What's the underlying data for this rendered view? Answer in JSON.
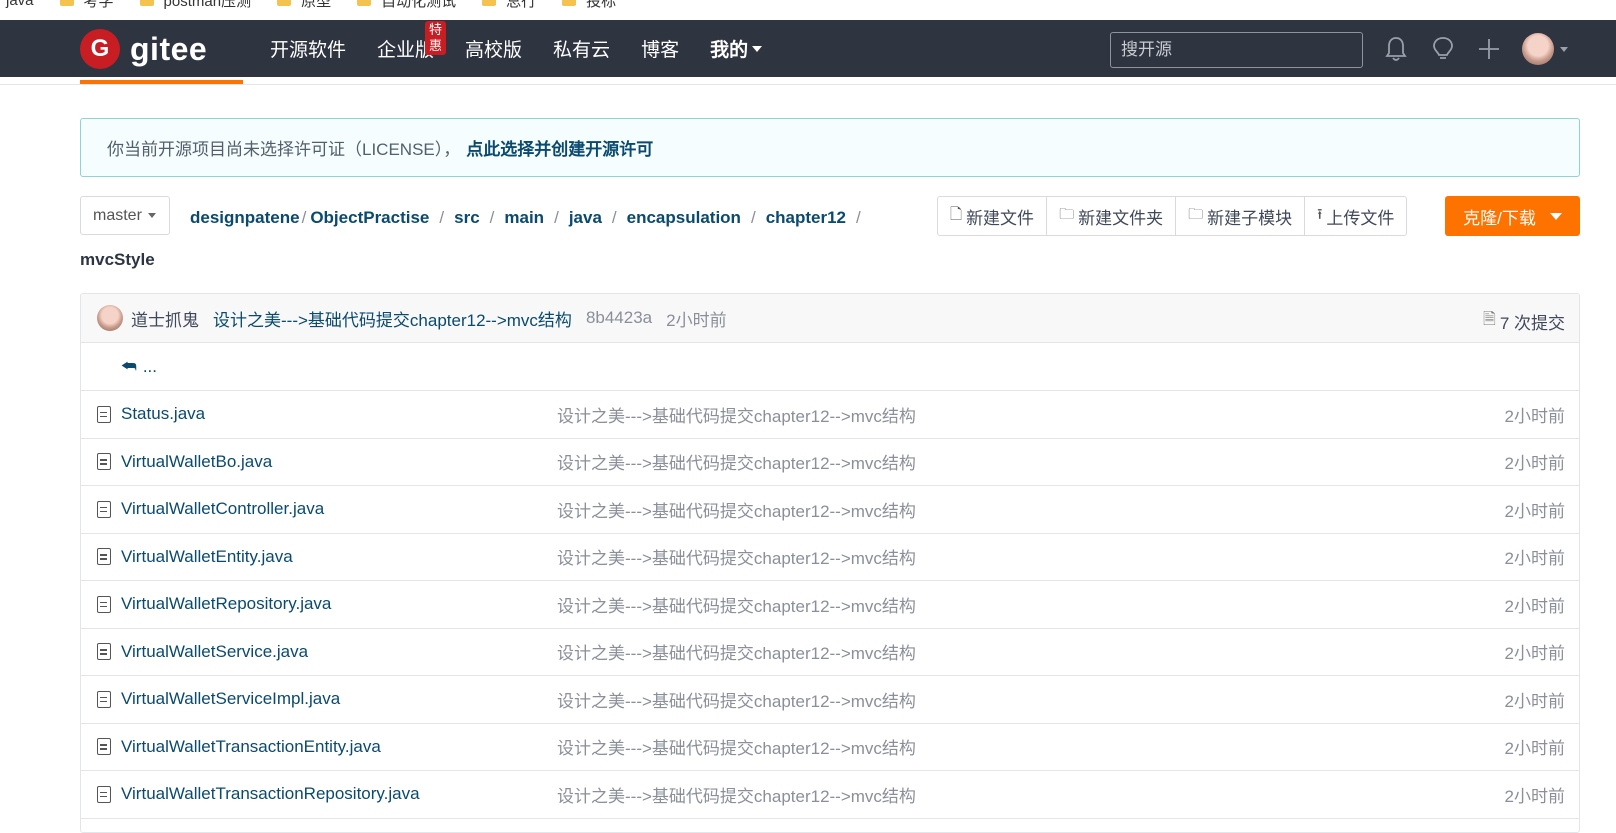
{
  "bookmarks": [
    "java",
    "考学",
    "postman压测",
    "原型",
    "自动化测试",
    "总行",
    "投标"
  ],
  "header": {
    "logo_text": "gitee",
    "nav": [
      {
        "label": "开源软件"
      },
      {
        "label": "企业版",
        "badge": "特惠"
      },
      {
        "label": "高校版"
      },
      {
        "label": "私有云"
      },
      {
        "label": "博客"
      },
      {
        "label": "我的"
      }
    ],
    "search_placeholder": "搜开源"
  },
  "notice": {
    "text": "你当前开源项目尚未选择许可证（LICENSE），",
    "link": "点此选择并创建开源许可"
  },
  "branch": "master",
  "breadcrumb": [
    "designpatene",
    "ObjectPractise",
    "src",
    "main",
    "java",
    "encapsulation",
    "chapter12"
  ],
  "current_dir": "mvcStyle",
  "toolbar": {
    "new_file": "新建文件",
    "new_folder": "新建文件夹",
    "new_submodule": "新建子模块",
    "upload": "上传文件",
    "clone": "克隆/下载"
  },
  "commit": {
    "author": "道士抓鬼",
    "message": "设计之美--->基础代码提交chapter12-->mvc结构",
    "sha": "8b4423a",
    "time": "2小时前",
    "count": "7 次提交"
  },
  "back_label": "...",
  "files": [
    {
      "name": "Status.java",
      "message": "设计之美--->基础代码提交chapter12-->mvc结构",
      "time": "2小时前"
    },
    {
      "name": "VirtualWalletBo.java",
      "message": "设计之美--->基础代码提交chapter12-->mvc结构",
      "time": "2小时前"
    },
    {
      "name": "VirtualWalletController.java",
      "message": "设计之美--->基础代码提交chapter12-->mvc结构",
      "time": "2小时前"
    },
    {
      "name": "VirtualWalletEntity.java",
      "message": "设计之美--->基础代码提交chapter12-->mvc结构",
      "time": "2小时前"
    },
    {
      "name": "VirtualWalletRepository.java",
      "message": "设计之美--->基础代码提交chapter12-->mvc结构",
      "time": "2小时前"
    },
    {
      "name": "VirtualWalletService.java",
      "message": "设计之美--->基础代码提交chapter12-->mvc结构",
      "time": "2小时前"
    },
    {
      "name": "VirtualWalletServiceImpl.java",
      "message": "设计之美--->基础代码提交chapter12-->mvc结构",
      "time": "2小时前"
    },
    {
      "name": "VirtualWalletTransactionEntity.java",
      "message": "设计之美--->基础代码提交chapter12-->mvc结构",
      "time": "2小时前"
    },
    {
      "name": "VirtualWalletTransactionRepository.java",
      "message": "设计之美--->基础代码提交chapter12-->mvc结构",
      "time": "2小时前"
    }
  ],
  "colors": {
    "header_bg": "#2f3441",
    "accent": "#fe7300",
    "brand": "#c71d23",
    "link": "#0a4a6f"
  }
}
